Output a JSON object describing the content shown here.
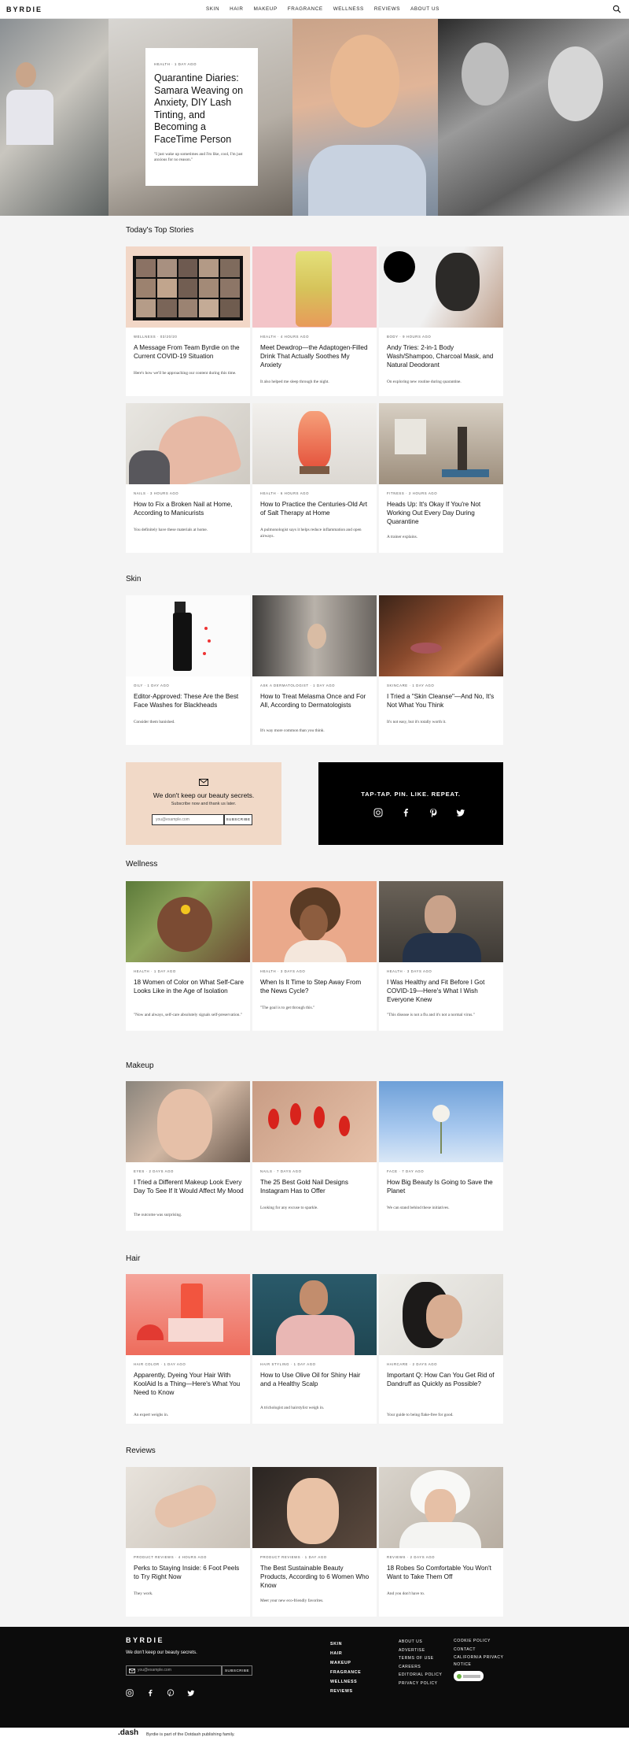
{
  "nav": {
    "logo": "BYRDIE",
    "items": [
      "SKIN",
      "HAIR",
      "MAKEUP",
      "FRAGRANCE",
      "WELLNESS",
      "REVIEWS",
      "ABOUT US"
    ]
  },
  "hero": {
    "meta": "HEALTH  ·  1 DAY AGO",
    "title": "Quarantine Diaries: Samara Weaving on Anxiety, DIY Lash Tinting, and Becoming a FaceTime Person",
    "dek": "\"I just wake up sometimes and I'm like, cool, I'm just anxious for no reason.\""
  },
  "sections": {
    "top": {
      "title": "Today's Top Stories",
      "cards": [
        {
          "meta": "WELLNESS  ·  03/20/20",
          "title": "A Message From Team Byrdie on the Current COVID-19 Situation",
          "dek": "Here's how we'll be approaching our content during this time."
        },
        {
          "meta": "HEALTH  ·  4 HOURS AGO",
          "title": "Meet Dewdrop—the Adaptogen-Filled Drink That Actually Soothes My Anxiety",
          "dek": "It also helped me sleep through the night."
        },
        {
          "meta": "BODY  ·  9 HOURS AGO",
          "title": "Andy Tries: 2-in-1 Body Wash/Shampoo, Charcoal Mask, and Natural Deodorant",
          "dek": "On exploring new routine during quarantine."
        },
        {
          "meta": "NAILS  ·  3 HOURS AGO",
          "title": "How to Fix a Broken Nail at Home, According to Manicurists",
          "dek": "You definitely have these materials at home."
        },
        {
          "meta": "HEALTH  ·  6 HOURS AGO",
          "title": "How to Practice the Centuries-Old Art of Salt Therapy at Home",
          "dek": "A pulmonologist says it helps reduce inflammation and open airways."
        },
        {
          "meta": "FITNESS  ·  2 HOURS AGO",
          "title": "Heads Up: It's Okay If You're Not Working Out Every Day During Quarantine",
          "dek": "A trainer explains."
        }
      ]
    },
    "skin": {
      "title": "Skin",
      "cards": [
        {
          "meta": "OILY  ·  1 DAY AGO",
          "title": "Editor-Approved: These Are the Best Face Washes for Blackheads",
          "dek": "Consider them banished."
        },
        {
          "meta": "ASK A DERMATOLOGIST  ·  1 DAY AGO",
          "title": "How to Treat Melasma Once and For All, According to Dermatologists",
          "dek": "It's way more common than you think."
        },
        {
          "meta": "SKINCARE  ·  1 DAY AGO",
          "title": "I Tried a \"Skin Cleanse\"—And No, It's Not What You Think",
          "dek": "It's not easy, but it's totally worth it."
        }
      ]
    },
    "wellness": {
      "title": "Wellness",
      "cards": [
        {
          "meta": "HEALTH  ·  1 DAY AGO",
          "title": "18 Women of Color on What Self-Care Looks Like in the Age of Isolation",
          "dek": "\"Now and always, self-care absolutely signals self-preservation.\""
        },
        {
          "meta": "HEALTH  ·  3 DAYS AGO",
          "title": "When Is It Time to Step Away From the News Cycle?",
          "dek": "\"The goal is to get through this.\""
        },
        {
          "meta": "HEALTH  ·  3 DAYS AGO",
          "title": "I Was Healthy and Fit Before I Got COVID-19—Here's What I Wish Everyone Knew",
          "dek": "\"This disease is not a flu and it's not a normal virus.\""
        }
      ]
    },
    "makeup": {
      "title": "Makeup",
      "cards": [
        {
          "meta": "EYES  ·  2 DAYS AGO",
          "title": "I Tried a Different Makeup Look Every Day To See If It Would Affect My Mood",
          "dek": "The outcome was surprising."
        },
        {
          "meta": "NAILS  ·  7 DAYS AGO",
          "title": "The 25 Best Gold Nail Designs Instagram Has to Offer",
          "dek": "Looking for any excuse to sparkle."
        },
        {
          "meta": "FACE  ·  7 DAY AGO",
          "title": "How Big Beauty Is Going to Save the Planet",
          "dek": "We can stand behind these initiatives."
        }
      ]
    },
    "hair": {
      "title": "Hair",
      "cards": [
        {
          "meta": "HAIR COLOR  ·  1 DAY AGO",
          "title": "Apparently, Dyeing Your Hair With KoolAid Is a Thing—Here's What You Need to Know",
          "dek": "An expert weighs in."
        },
        {
          "meta": "HAIR STYLING  ·  1 DAY AGO",
          "title": "How to Use Olive Oil for Shiny Hair and a Healthy Scalp",
          "dek": "A trichologist and hairstylist weigh in."
        },
        {
          "meta": "HAIRCARE  ·  2 DAYS AGO",
          "title": "Important Q: How Can You Get Rid of Dandruff as Quickly as Possible?",
          "dek": "Your guide to being flake-free for good."
        }
      ]
    },
    "reviews": {
      "title": "Reviews",
      "cards": [
        {
          "meta": "PRODUCT REVIEWS  ·  4 HOURS AGO",
          "title": "Perks to Staying Inside: 6 Foot Peels to Try Right Now",
          "dek": "They work."
        },
        {
          "meta": "PRODUCT REVIEWS  ·  1 DAY AGO",
          "title": "The Best Sustainable Beauty Products, According to 6 Women Who Know",
          "dek": "Meet your new eco-friendly favorites."
        },
        {
          "meta": "REVIEWS  ·  2 DAYS AGO",
          "title": "18 Robes So Comfortable You Won't Want to Take Them Off",
          "dek": "And you don't have to."
        }
      ]
    }
  },
  "newsletter": {
    "headline": "We don't keep our beauty secrets.",
    "sub": "Subscribe now and thank us later.",
    "placeholder": "you@example.com",
    "button": "SUBSCRIBE"
  },
  "social": {
    "headline": "TAP-TAP. PIN. LIKE. REPEAT."
  },
  "footer": {
    "logo": "BYRDIE",
    "tagline": "We don't keep our beauty secrets.",
    "placeholder": "you@example.com",
    "button": "SUBSCRIBE",
    "nav": [
      "SKIN",
      "HAIR",
      "MAKEUP",
      "FRAGRANCE",
      "WELLNESS",
      "REVIEWS"
    ],
    "links1": [
      "ABOUT US",
      "ADVERTISE",
      "TERMS OF USE",
      "CAREERS",
      "EDITORIAL POLICY",
      "PRIVACY POLICY"
    ],
    "links2": [
      "COOKIE POLICY",
      "CONTACT",
      "CALIFORNIA PRIVACY NOTICE"
    ],
    "dash_logo": ".dash",
    "dash_text": "Byrdie is part of the Dotdash publishing family."
  }
}
